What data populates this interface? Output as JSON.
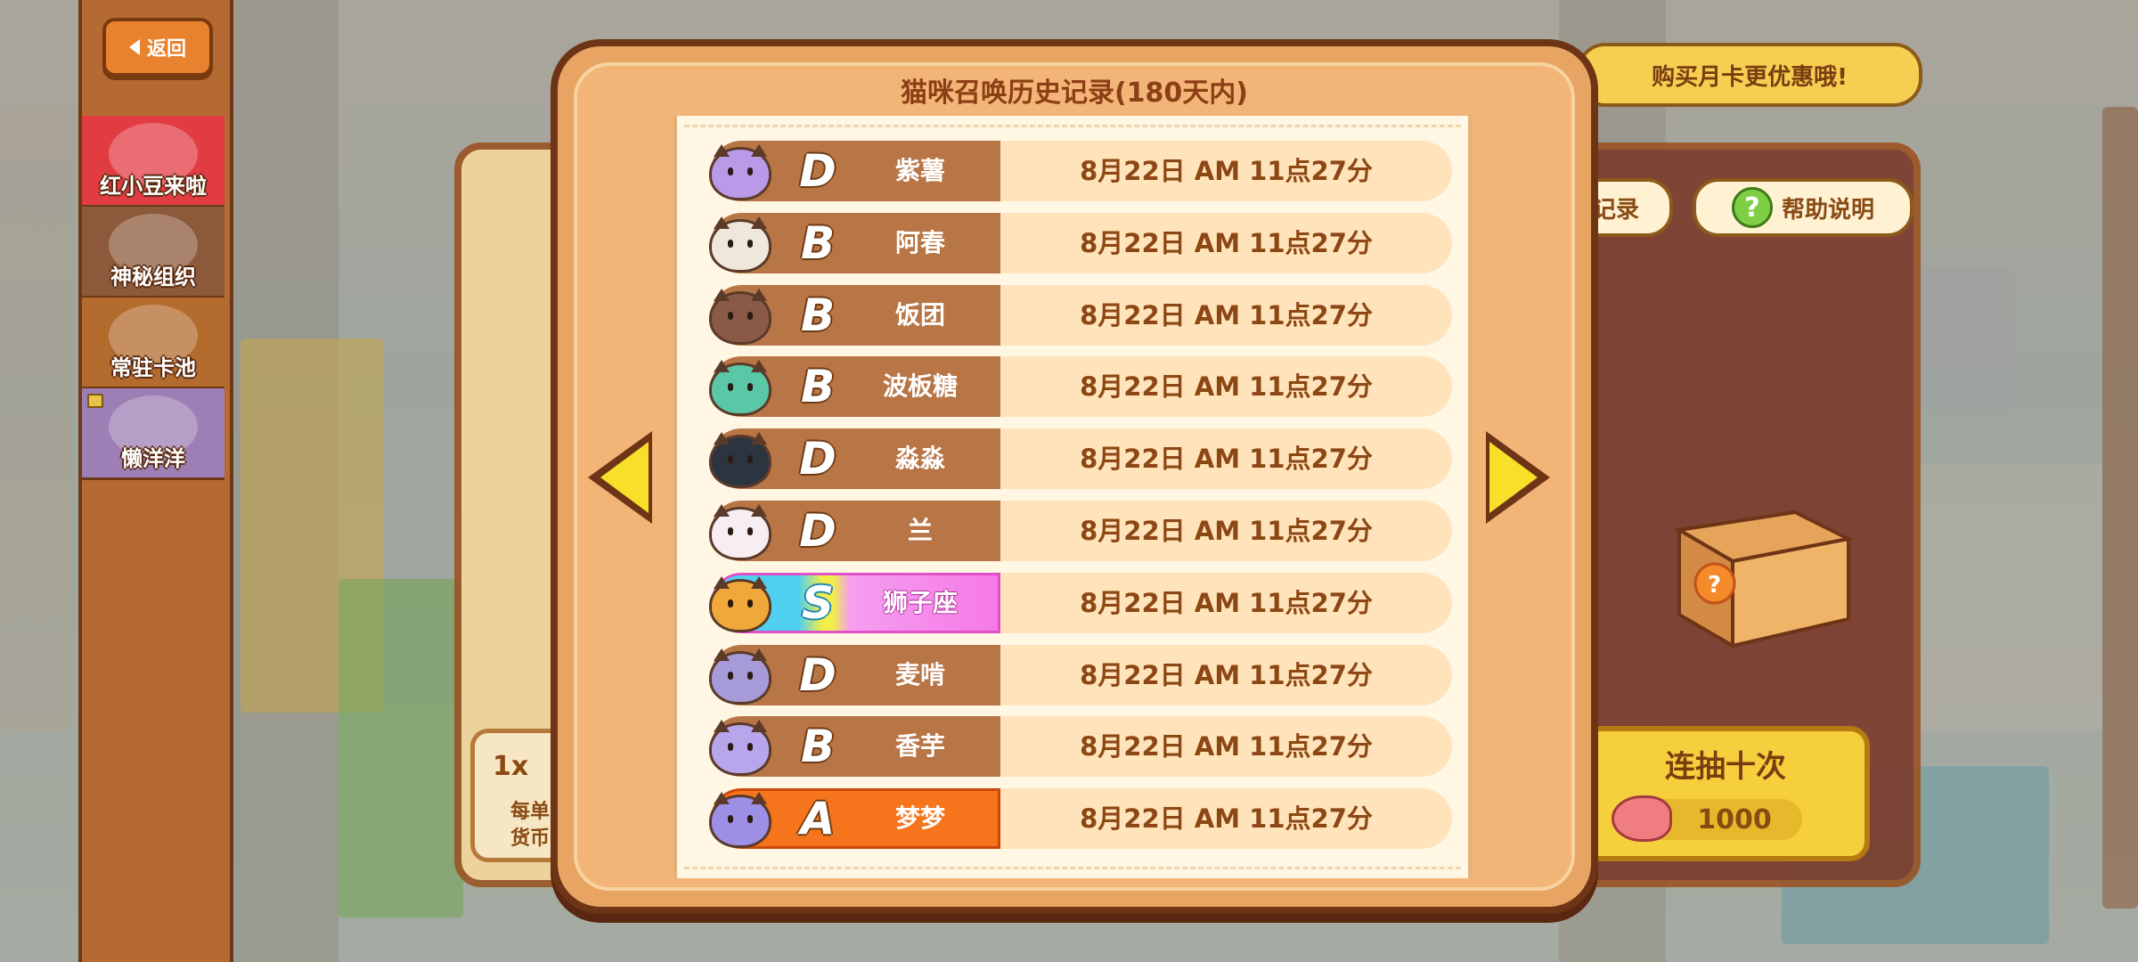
{
  "back_button": {
    "label": "返回"
  },
  "sidebar": {
    "tabs": [
      {
        "label": "红小豆来啦",
        "bg": "#e23c43"
      },
      {
        "label": "神秘组织",
        "bg": "#8c5a3a"
      },
      {
        "label": "常驻卡池",
        "bg": "#b46b2e"
      },
      {
        "label": "懒洋洋",
        "bg": "#9d7fb5"
      }
    ]
  },
  "modal": {
    "title": "猫咪召唤历史记录(180天内)",
    "records": [
      {
        "grade": "D",
        "name": "紫薯",
        "time": "8月22日 AM 11点27分",
        "rank": "d",
        "cat_color": "#b99ae8"
      },
      {
        "grade": "B",
        "name": "阿春",
        "time": "8月22日 AM 11点27分",
        "rank": "b",
        "cat_color": "#efe6dc"
      },
      {
        "grade": "B",
        "name": "饭团",
        "time": "8月22日 AM 11点27分",
        "rank": "b",
        "cat_color": "#8b5a46"
      },
      {
        "grade": "B",
        "name": "波板糖",
        "time": "8月22日 AM 11点27分",
        "rank": "b",
        "cat_color": "#5ac7a6"
      },
      {
        "grade": "D",
        "name": "淼淼",
        "time": "8月22日 AM 11点27分",
        "rank": "d",
        "cat_color": "#2c3440"
      },
      {
        "grade": "D",
        "name": "兰",
        "time": "8月22日 AM 11点27分",
        "rank": "d",
        "cat_color": "#f6eef2"
      },
      {
        "grade": "S",
        "name": "狮子座",
        "time": "8月22日 AM 11点27分",
        "rank": "s",
        "cat_color": "#f1a83a"
      },
      {
        "grade": "D",
        "name": "麦啃",
        "time": "8月22日 AM 11点27分",
        "rank": "d",
        "cat_color": "#a79ad8"
      },
      {
        "grade": "B",
        "name": "香芋",
        "time": "8月22日 AM 11点27分",
        "rank": "b",
        "cat_color": "#b7a6ec"
      },
      {
        "grade": "A",
        "name": "梦梦",
        "time": "8月22日 AM 11点27分",
        "rank": "a",
        "cat_color": "#9d8fe6"
      }
    ]
  },
  "background_ui": {
    "monthly_card_banner": "购买月卡更优惠哦!",
    "record_button_partial": "记录",
    "help_button": "帮助说明",
    "ten_pull": {
      "label": "连抽十次",
      "cost": "1000"
    },
    "single_pull_partial": "1x",
    "single_pull_note_1": "每单",
    "single_pull_note_2": "货币"
  }
}
